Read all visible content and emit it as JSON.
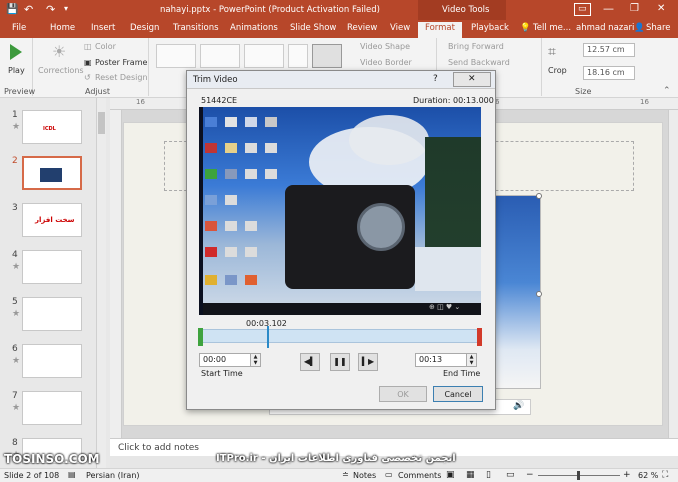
{
  "window": {
    "title": "nahayi.pptx - PowerPoint (Product Activation Failed)",
    "context_group": "Video Tools",
    "help": "?",
    "minimize": "—",
    "restore": "❐",
    "close": "✕"
  },
  "qat": {
    "save": "💾",
    "undo": "↶",
    "redo": "↷",
    "customize": "▾"
  },
  "tabs": {
    "file": "File",
    "home": "Home",
    "insert": "Insert",
    "design": "Design",
    "transitions": "Transitions",
    "animations": "Animations",
    "slideshow": "Slide Show",
    "review": "Review",
    "view": "View",
    "format": "Format",
    "playback": "Playback",
    "tellme": "Tell me...",
    "user": "ahmad nazari",
    "share": "Share"
  },
  "ribbon": {
    "play": "Play",
    "corrections": "Corrections",
    "color": "Color",
    "poster_frame": "Poster Frame",
    "reset_design": "Reset Design",
    "video_shape": "Video Shape",
    "video_border": "Video Border",
    "bring_forward": "Bring Forward",
    "send_backward": "Send Backward",
    "crop": "Crop",
    "height": "12.57 cm",
    "width": "18.16 cm"
  },
  "group_labels": {
    "preview": "Preview",
    "adjust": "Adjust",
    "size": "Size"
  },
  "slides": [
    {
      "num": "1",
      "title": "ICDL"
    },
    {
      "num": "2",
      "title": ""
    },
    {
      "num": "3",
      "title": "سخت افزار"
    },
    {
      "num": "4",
      "title": ""
    },
    {
      "num": "5",
      "title": ""
    },
    {
      "num": "6",
      "title": ""
    },
    {
      "num": "7",
      "title": ""
    },
    {
      "num": "8",
      "title": ""
    }
  ],
  "dialog": {
    "title": "Trim Video",
    "help": "?",
    "close": "✕",
    "filename": "51442CE",
    "duration": "Duration: 00:13.000",
    "current_time": "00:03.102",
    "start_value": "00:00",
    "start_label": "Start Time",
    "end_value": "00:13",
    "end_label": "End Time",
    "ok": "OK",
    "cancel": "Cancel",
    "prev": "◀▍",
    "pause": "❚❚",
    "next": "▍▶"
  },
  "notes": {
    "placeholder": "Click to add notes"
  },
  "watermark": {
    "left": "TOSINSO.COM",
    "right": "ITPro.ir - انجمن تخصصی فناوری اطلاعات ایران"
  },
  "status": {
    "slide_info": "Slide 2 of 108",
    "language": "Persian (Iran)",
    "notes": "Notes",
    "comments": "Comments",
    "zoom": "62 %"
  },
  "colors": {
    "accent": "#b7472a",
    "timeline": "#cfe3f3",
    "start_marker": "#3fa33f",
    "end_marker": "#d23a2a"
  },
  "trim": {
    "current_fraction": 0.239
  }
}
